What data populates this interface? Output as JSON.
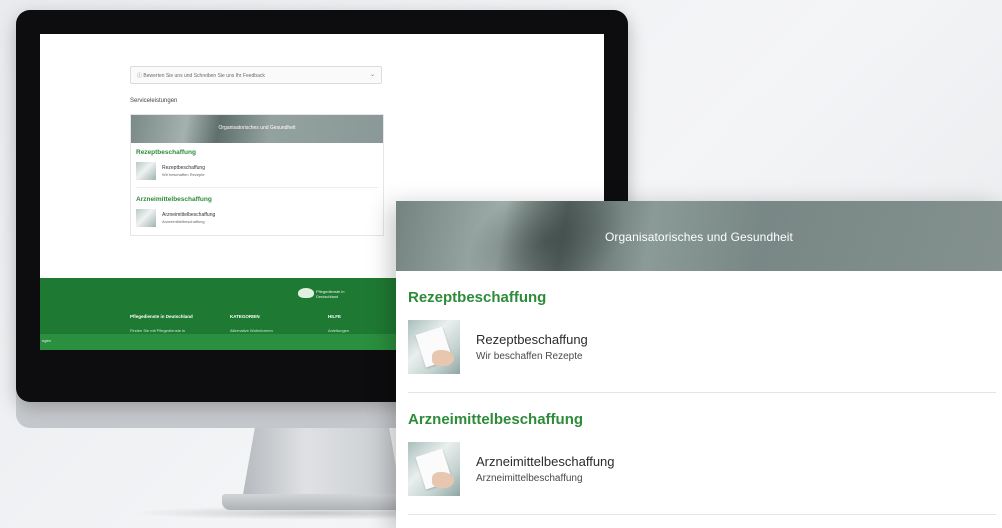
{
  "screen": {
    "feedback_text": "Bewerten Sie uns und Schreiben Sie uns Ihr Feedback",
    "section_label": "Serviceleistungen",
    "footer": {
      "logo_text": "Pflegedienste in Deutschland",
      "col1_title": "Pflegedienste in Deutschland",
      "col2_title": "KATEGORIEN",
      "col3_title": "HILFE",
      "col1_text": "Finden Sie mit Pflegedienste in",
      "col2_text": "Alternative Wohnformen",
      "col3_text": "Anleitungen",
      "strip_text": "ngen"
    }
  },
  "card": {
    "banner_title": "Organisatorisches und Gesundheit",
    "categories": [
      {
        "title": "Rezeptbeschaffung",
        "item_title": "Rezeptbeschaffung",
        "item_subtitle": "Wir beschaffen Rezepte"
      },
      {
        "title": "Arzneimittelbeschaffung",
        "item_title": "Arzneimittelbeschaffung",
        "item_subtitle": "Arzneimittelbeschaffung"
      }
    ]
  },
  "icons": {
    "feedback_prefix": "info-icon",
    "dropdown": "chevron-down-icon",
    "logo": "heart-hands-logo-icon"
  },
  "colors": {
    "brand_green": "#2e8b3a",
    "footer_green": "#1e7a32"
  }
}
